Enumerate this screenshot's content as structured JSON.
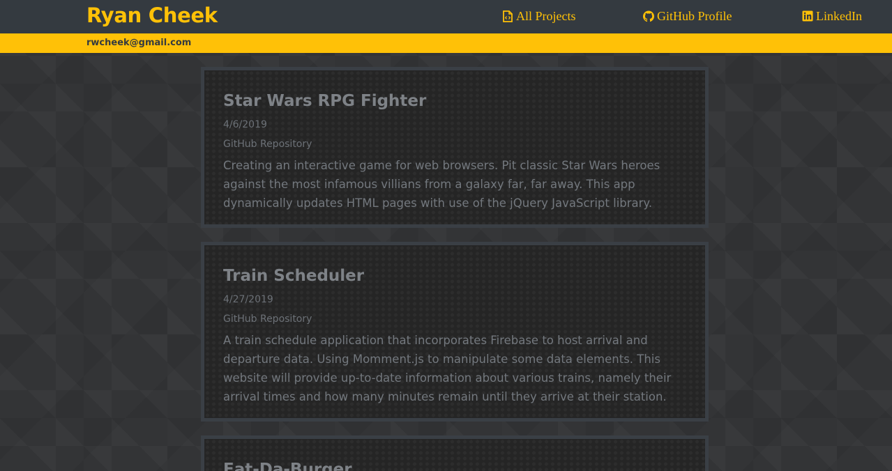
{
  "header": {
    "brand": "Ryan Cheek",
    "nav": [
      {
        "label": "All Projects",
        "icon": "file-code-icon"
      },
      {
        "label": "GitHub Profile",
        "icon": "github-icon"
      },
      {
        "label": "LinkedIn",
        "icon": "linkedin-icon"
      }
    ],
    "email": "rwcheek@gmail.com"
  },
  "colors": {
    "accent": "#ffc107",
    "navbar": "#343a40",
    "card_bg": "#252525",
    "card_border": "#3a3f45",
    "muted_text": "#7e8287"
  },
  "projects": [
    {
      "title": "Star Wars RPG Fighter",
      "date": "4/6/2019",
      "link": "GitHub Repository",
      "description": "Creating an interactive game for web browsers. Pit classic Star Wars heroes against the most infamous villians from a galaxy far, far away. This app dynamically updates HTML pages with use of the jQuery JavaScript library."
    },
    {
      "title": "Train Scheduler",
      "date": "4/27/2019",
      "link": "GitHub Repository",
      "description": "A train schedule application that incorporates Firebase to host arrival and departure data. Using Momment.js to manipulate some data elements. This website will provide up-to-date information about various trains, namely their arrival times and how many minutes remain until they arrive at their station."
    },
    {
      "title": "Eat-Da-Burger"
    }
  ]
}
